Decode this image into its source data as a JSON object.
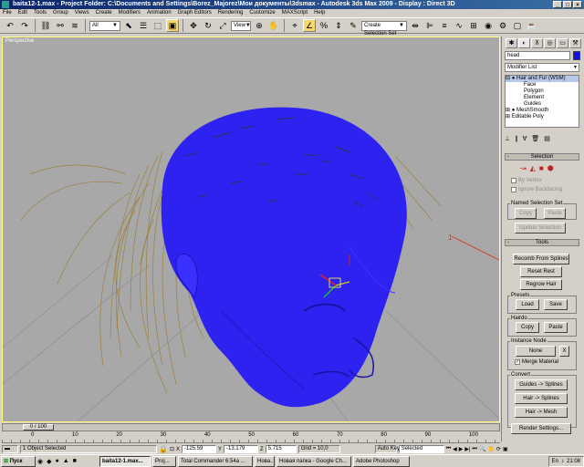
{
  "window": {
    "title": "baita12-1.max   - Project Folder: C:\\Documents and Settings\\Borez_Majorez\\Мои документы\\3dsmax    - Autodesk 3ds Max 2009      - Display : Direct 3D"
  },
  "menu": [
    "File",
    "Edit",
    "Tools",
    "Group",
    "Views",
    "Create",
    "Modifiers",
    "Animation",
    "Graph Editors",
    "Rendering",
    "Customize",
    "MAXScript",
    "Help"
  ],
  "toolbar": {
    "selection_filter": "All",
    "reference_coord": "View",
    "named_selection": "Create Selection Set"
  },
  "viewport": {
    "label": "Perspective",
    "callout": "1"
  },
  "command_panel": {
    "object_name": "head",
    "modifier_list": "Modifier List",
    "stack": [
      "Hair and Fur (WSM)",
      "Face",
      "Polygon",
      "Element",
      "Guides",
      "MeshSmooth",
      "Editable Poly"
    ],
    "selection_rollout": "Selection",
    "by_vertex": "By Vertex",
    "ignore_backfacing": "Ignore Backfacing",
    "named_selection_set": "Named Selection Set",
    "copy": "Copy",
    "paste": "Paste",
    "update_selection": "Update Selection",
    "tools_rollout": "Tools",
    "recomb_from_splines": "Recomb From Splines",
    "reset_rest": "Reset Rest",
    "regrow_hair": "Regrow Hair",
    "presets": "Presets",
    "load": "Load",
    "save": "Save",
    "hairdo": "Hairdo",
    "instance_node": "Instance Node",
    "none": "None",
    "x": "X",
    "merge_material": "Merge Material",
    "convert": "Convert",
    "guides_to_splines": "Guides -> Splines",
    "hair_to_splines": "Hair -> Splines",
    "hair_to_mesh": "Hair -> Mesh",
    "render_settings": "Render Settings..."
  },
  "timeline": {
    "frame": "0 / 100",
    "ticks": [
      "0",
      "10",
      "20",
      "30",
      "40",
      "50",
      "60",
      "70",
      "80",
      "90",
      "100"
    ]
  },
  "status": {
    "selected": "1 Object Selected",
    "x": "-125.59",
    "y": "-13.179",
    "z": "5.715",
    "grid": "Grid = 10,0",
    "auto_key": "Auto Key",
    "key_mode": "Selected"
  },
  "taskbar": {
    "start": "Пуск",
    "items": [
      "baita12-1.max...",
      "Proj...",
      "Total Commander 6.54a ...",
      "Нова...",
      "Новая папка - Google Ch...",
      "Adobe Photoshop"
    ],
    "lang": "En",
    "clock": "21:08"
  }
}
